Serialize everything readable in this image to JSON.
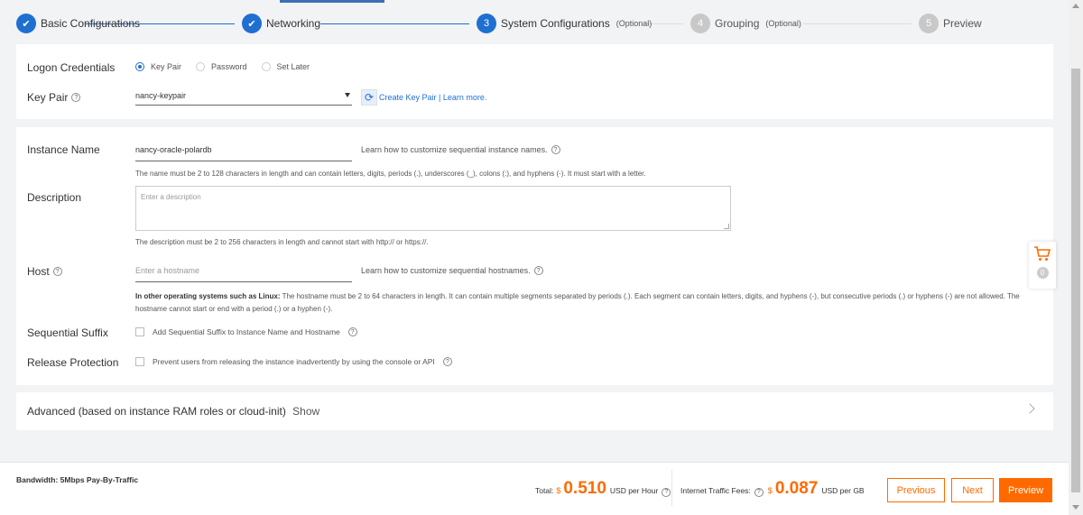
{
  "steps": [
    {
      "num": "1",
      "label": "Basic Configurations",
      "optional": "",
      "state": "done"
    },
    {
      "num": "2",
      "label": "Networking",
      "optional": "",
      "state": "done"
    },
    {
      "num": "3",
      "label": "System Configurations",
      "optional": "(Optional)",
      "state": "active"
    },
    {
      "num": "4",
      "label": "Grouping",
      "optional": "(Optional)",
      "state": "todo"
    },
    {
      "num": "5",
      "label": "Preview",
      "optional": "",
      "state": "todo"
    }
  ],
  "logon": {
    "label": "Logon Credentials",
    "options": [
      "Key Pair",
      "Password",
      "Set Later"
    ],
    "selected": "Key Pair"
  },
  "keypair": {
    "label": "Key Pair",
    "value": "nancy-keypair",
    "create_link": "Create Key Pair",
    "separator": "|",
    "learn_link": "Learn more."
  },
  "instance_name": {
    "label": "Instance Name",
    "value": "nancy-oracle-polardb",
    "hint": "Learn how to customize sequential instance names.",
    "help": "The name must be 2 to 128 characters in length and can contain letters, digits, periods (.), underscores (_), colons (:), and hyphens (-). It must start with a letter."
  },
  "description": {
    "label": "Description",
    "placeholder": "Enter a description",
    "help": "The description must be 2 to 256 characters in length and cannot start with http:// or https://."
  },
  "host": {
    "label": "Host",
    "placeholder": "Enter a hostname",
    "hint": "Learn how to customize sequential hostnames.",
    "help_bold": "In other operating systems such as Linux:",
    "help": " The hostname must be 2 to 64 characters in length. It can contain multiple segments separated by periods (.). Each segment can contain letters, digits, and hyphens (-), but consecutive periods (.) or hyphens (-) are not allowed. The hostname cannot start or end with a period (.) or a hyphen (-)."
  },
  "sequential_suffix": {
    "label": "Sequential Suffix",
    "checkbox": "Add Sequential Suffix to Instance Name and Hostname"
  },
  "release_protection": {
    "label": "Release Protection",
    "checkbox": "Prevent users from releasing the instance inadvertently by using the console or API"
  },
  "advanced": {
    "label": "Advanced (based on instance RAM roles or cloud-init)",
    "show": "Show"
  },
  "cart": {
    "count": "0"
  },
  "footer": {
    "bandwidth": "Bandwidth: 5Mbps Pay-By-Traffic",
    "total_label": "Total:",
    "total_currency": "$",
    "total_amount": "0.510",
    "total_unit": "USD per Hour",
    "traffic_label": "Internet Traffic Fees:",
    "traffic_currency": "$",
    "traffic_amount": "0.087",
    "traffic_unit": "USD per GB",
    "previous": "Previous",
    "next": "Next",
    "preview": "Preview"
  },
  "colors": {
    "accent": "#ff6a00",
    "primary": "#1f6fd1"
  }
}
